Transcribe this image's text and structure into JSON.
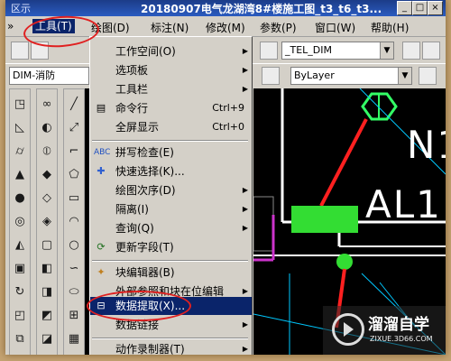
{
  "window": {
    "title": "20180907电气龙湖湾8#楼施工图_t3_t6_t3...",
    "title_left": "区示"
  },
  "menubar": {
    "items": [
      {
        "label": "工具(T)",
        "active": true
      },
      {
        "label": "绘图(D)"
      },
      {
        "label": "标注(N)"
      },
      {
        "label": "修改(M)"
      },
      {
        "label": "参数(P)"
      },
      {
        "label": "窗口(W)"
      },
      {
        "label": "帮助(H)"
      }
    ]
  },
  "toolbar": {
    "dim_style": "_TEL_DIM",
    "layer": "ByLayer",
    "style_combo": "DIM-消防"
  },
  "tools_menu": {
    "items": [
      {
        "label": "工作空间(O)",
        "submenu": true
      },
      {
        "label": "选项板",
        "submenu": true
      },
      {
        "label": "工具栏",
        "submenu": true
      },
      {
        "label": "命令行",
        "shortcut": "Ctrl+9",
        "icon": "command-line-icon"
      },
      {
        "label": "全屏显示",
        "shortcut": "Ctrl+0"
      },
      {
        "label": "拼写检查(E)",
        "icon": "spell-check-icon"
      },
      {
        "label": "快速选择(K)...",
        "icon": "quick-select-icon"
      },
      {
        "label": "绘图次序(D)",
        "submenu": true
      },
      {
        "label": "隔离(I)",
        "submenu": true
      },
      {
        "label": "查询(Q)",
        "submenu": true
      },
      {
        "label": "更新字段(T)",
        "icon": "update-field-icon"
      },
      {
        "label": "块编辑器(B)",
        "icon": "block-editor-icon"
      },
      {
        "label": "外部参照和块在位编辑",
        "submenu": true
      },
      {
        "label": "数据提取(X)...",
        "highlighted": true,
        "icon": "data-extraction-icon"
      },
      {
        "label": "数据链接",
        "submenu": true
      },
      {
        "label": "动作录制器(T)",
        "submenu": true
      }
    ]
  },
  "drawing": {
    "labels": [
      "N1",
      "AL1"
    ]
  },
  "watermark": {
    "name": "溜溜自学",
    "url": "ZIXUE.3D66.COM"
  },
  "colors": {
    "menu_highlight": "#0a246a",
    "annotation": "#e02020",
    "drawing_bg": "#000000"
  }
}
